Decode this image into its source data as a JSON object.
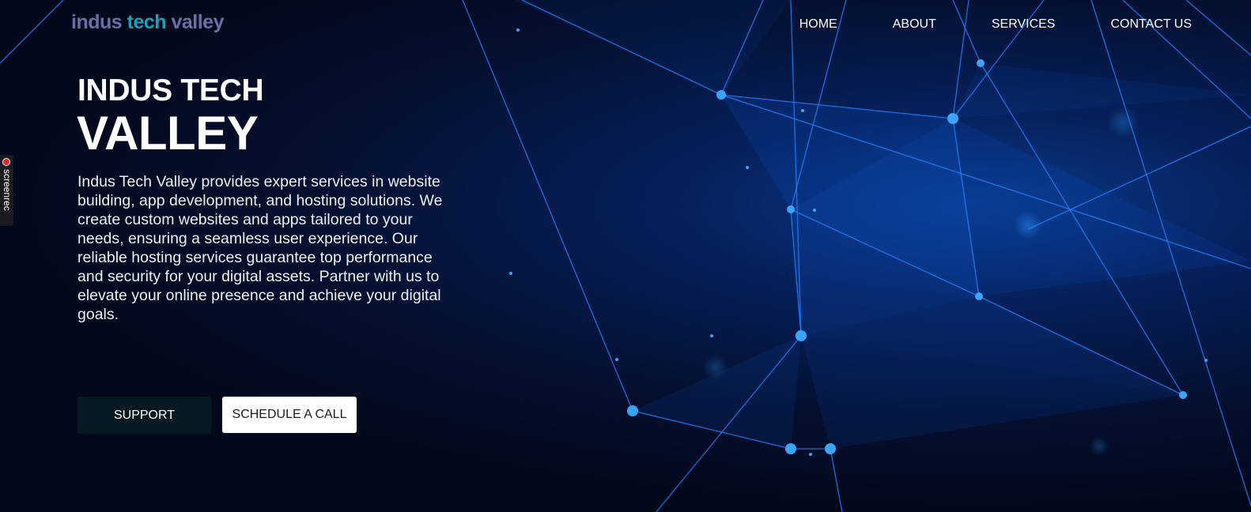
{
  "brand": {
    "word1": "indus",
    "word2": "tech",
    "word3": "valley"
  },
  "nav": {
    "items": [
      {
        "label": "HOME"
      },
      {
        "label": "ABOUT"
      },
      {
        "label": "SERVICES"
      },
      {
        "label": "CONTACT US"
      }
    ]
  },
  "hero": {
    "title_line1": "INDUS TECH",
    "title_line2": "VALLEY",
    "description": "Indus Tech Valley provides expert services in website building, app development, and hosting solutions. We create custom websites and apps tailored to your needs, ensuring a seamless user experience. Our reliable hosting services guarantee top performance and security for your digital assets. Partner with us to elevate your online presence and achieve your digital goals.",
    "primary_button": "SUPPORT",
    "secondary_button": "SCHEDULE A CALL"
  },
  "recorder": {
    "label": "screenrec"
  },
  "colors": {
    "background": "#03081a",
    "accent_blue": "#0a3a8c",
    "logo_purple": "#6a6fa8",
    "logo_teal": "#1aa4b8",
    "support_button_bg": "#061820",
    "schedule_button_bg": "#ffffff"
  }
}
